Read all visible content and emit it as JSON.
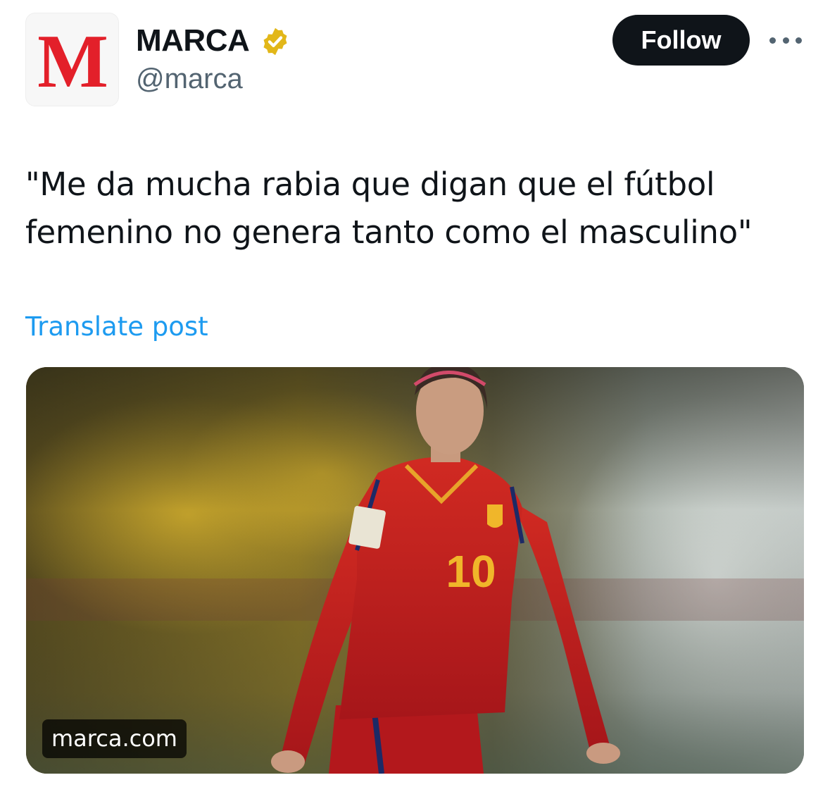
{
  "author": {
    "display_name": "MARCA",
    "handle": "@marca",
    "avatar_letter": "M",
    "avatar_icon": "marca-logo-icon",
    "verified_badge": "gold-verified-badge-icon"
  },
  "actions": {
    "follow_label": "Follow",
    "more_icon": "more-horizontal-icon"
  },
  "post": {
    "text": "\"Me da mucha rabia que digan que el fútbol femenino no genera tanto como el masculino\"",
    "translate_label": "Translate post"
  },
  "link_card": {
    "domain": "marca.com",
    "image_description_icon": "player-photo-image",
    "jersey_number": "10"
  },
  "colors": {
    "brand_red": "#e3202a",
    "follow_bg": "#0f1419",
    "link_blue": "#1d9bf0",
    "secondary_text": "#536471",
    "verified_gold": "#e2b719"
  }
}
